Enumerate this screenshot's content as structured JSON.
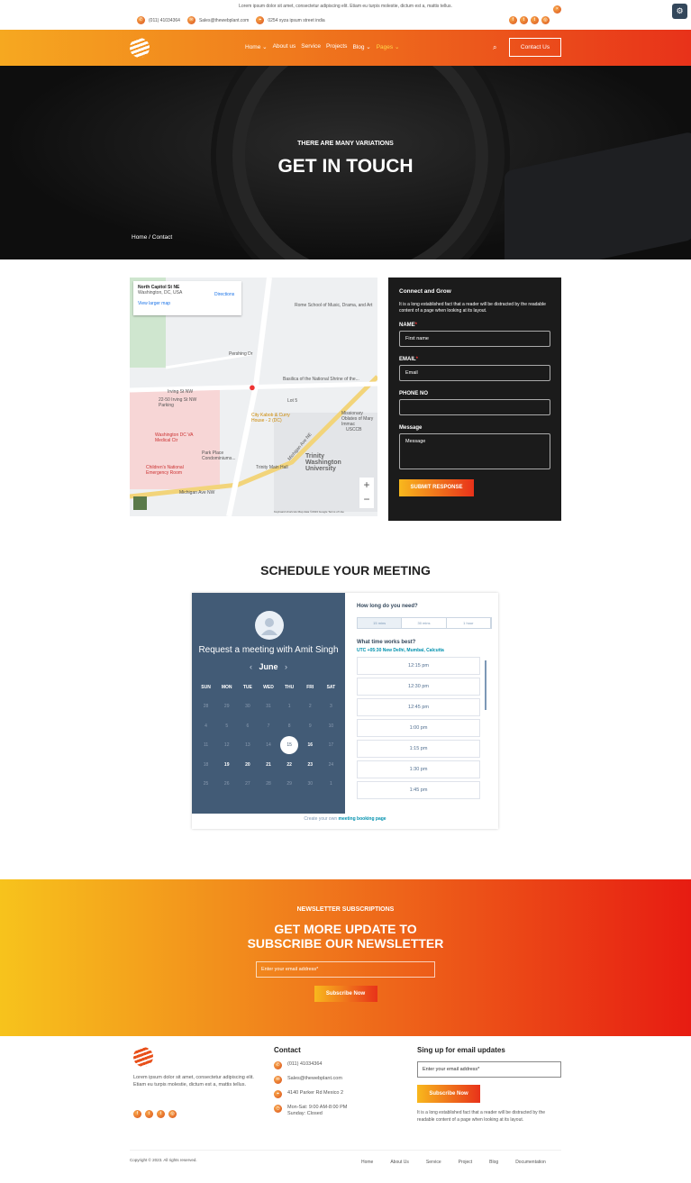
{
  "topbar": {
    "message": "Lorem ipsum dolor sit amet, consectetur adipiscing elit. Etiam eu turpis molestie, dictum est a, mattis tellus.",
    "phone": "(011) 41034364",
    "email": "Sales@thewebplant.com",
    "address": "0254 xyza ipsum street india",
    "social": [
      "facebook-icon",
      "twitter-icon",
      "tumblr-icon",
      "instagram-icon"
    ]
  },
  "nav": {
    "items": [
      {
        "label": "Home ⌄"
      },
      {
        "label": "About us"
      },
      {
        "label": "Service"
      },
      {
        "label": "Projects"
      },
      {
        "label": "Blog ⌄"
      },
      {
        "label": "Pages ⌄"
      }
    ],
    "active": "Pages",
    "contact_button": "Contact Us"
  },
  "hero": {
    "subtitle": "THERE ARE MANY VARIATIONS",
    "title": "GET IN TOUCH",
    "breadcrumb_home": "Home /",
    "breadcrumb_current": "Contact"
  },
  "map": {
    "place": "North Capitol St NE",
    "address": "Washington, DC, USA",
    "directions": "Directions",
    "larger": "View larger map",
    "labels": [
      "Rome School of Music, Drama, and Art",
      "Basilica of the National Shrine of the...",
      "Irving St NW",
      "22-50 Irving St NW Parking",
      "Washington DC VA Medical Ctr",
      "City Kabob & Curry House - 2 (DC)",
      "Lot 5",
      "Trinity Washington University",
      "Trinity Main Hall",
      "Park Place Condominiums...",
      "Children's National Emergency Room",
      "Michigan Ave NW",
      "Michigan Ave NE",
      "USCCB",
      "Missionary Oblates of Mary Immac",
      "Pershing Dr"
    ],
    "footer": "Keyboard shortcuts   Map data ©2023 Google   Terms of Use"
  },
  "form": {
    "title": "Connect and Grow",
    "desc": "It is a long established fact that a reader will be distracted by the readable content of a page when looking at its layout.",
    "name_label": "NAME",
    "name_ph": "First name",
    "email_label": "EMAIL",
    "email_ph": "Email",
    "phone_label": "PHONE NO",
    "message_label": "Message",
    "message_ph": "Message",
    "submit": "SUBMIT RESPONSE"
  },
  "schedule": {
    "title": "SCHEDULE YOUR MEETING",
    "request": "Request a meeting with Amit Singh",
    "month": "June",
    "days": [
      "SUN",
      "MON",
      "TUE",
      "WED",
      "THU",
      "FRI",
      "SAT"
    ],
    "dates": [
      "28",
      "29",
      "30",
      "31",
      "1",
      "2",
      "3",
      "4",
      "5",
      "6",
      "7",
      "8",
      "9",
      "10",
      "11",
      "12",
      "13",
      "14",
      "15",
      "16",
      "17",
      "18",
      "19",
      "20",
      "21",
      "22",
      "23",
      "24",
      "25",
      "26",
      "27",
      "28",
      "29",
      "30",
      "1"
    ],
    "available": [
      "16",
      "19",
      "20",
      "21",
      "22",
      "23"
    ],
    "selected": "15",
    "duration_q": "How long do you need?",
    "durations": [
      "15 mins",
      "30 mins",
      "1 hour"
    ],
    "selected_duration": "15 mins",
    "time_q": "What time works best?",
    "timezone": "UTC +05:30 New Delhi, Mumbai, Calcutta",
    "slots": [
      "12:15 pm",
      "12:30 pm",
      "12:45 pm",
      "1:00 pm",
      "1:15 pm",
      "1:30 pm",
      "1:45 pm"
    ],
    "footer_pre": "Create your own ",
    "footer_link": "meeting booking page"
  },
  "newsletter": {
    "subtitle": "NEWSLETTER SUBSCRIPTIONS",
    "title1": "GET MORE UPDATE TO",
    "title2": "SUBSCRIBE OUR NEWSLETTER",
    "placeholder": "Enter your email address*",
    "button": "Subscribe Now"
  },
  "footer": {
    "about": "Lorem ipsum dolor sit amet, consectetur adipiscing elit. Etiam eu turpis molestie, dictum est a, mattis tellus.",
    "contact_title": "Contact",
    "phone": "(011) 41034364",
    "email": "Sales@thewebplant.com",
    "address": "4140 Parker Rd Mexico 2",
    "hours1": "Mon-Sat: 9:00 AM-8:00 PM",
    "hours2": "Sunday: Closed",
    "signup_title": "Sing up for email updates",
    "signup_ph": "Enter your email address*",
    "signup_button": "Subscribe Now",
    "signup_desc": "It is a long established fact that a reader will be distracted by the readable content of a page when looking at its layout.",
    "copyright": "Copyright © 2023.  All rights reserved.",
    "links": [
      "Home",
      "About Us",
      "Service",
      "Project",
      "Blog",
      "Documentation"
    ]
  },
  "colors": {
    "accent_start": "#f6a820",
    "accent_end": "#e8321a",
    "calendar_bg": "#425b76",
    "form_bg": "#1b1b1b"
  }
}
